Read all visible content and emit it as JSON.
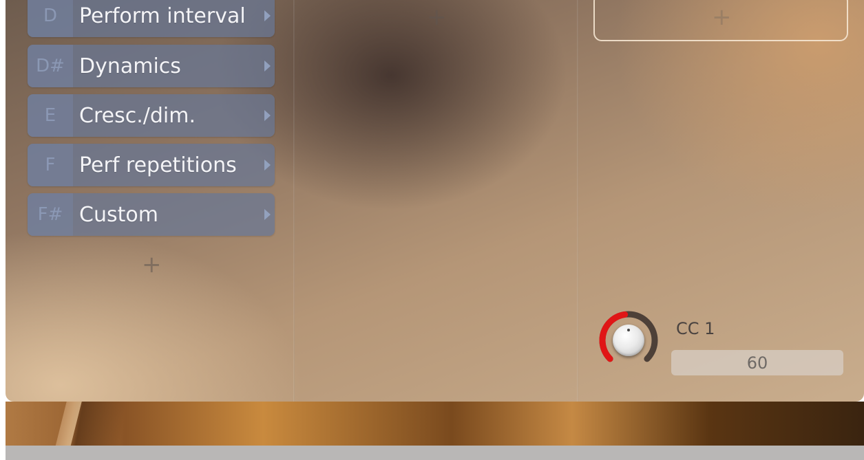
{
  "articulations": [
    {
      "note": "D",
      "label": "Perform interval"
    },
    {
      "note": "D#",
      "label": "Dynamics"
    },
    {
      "note": "E",
      "label": "Cresc./dim."
    },
    {
      "note": "F",
      "label": "Perf repetitions"
    },
    {
      "note": "F#",
      "label": "Custom"
    }
  ],
  "add_symbol": "+",
  "controller": {
    "label": "CC 1",
    "value": "60",
    "level": 0.47,
    "arc_color": "#e01616",
    "track_color": "#4d4038"
  }
}
